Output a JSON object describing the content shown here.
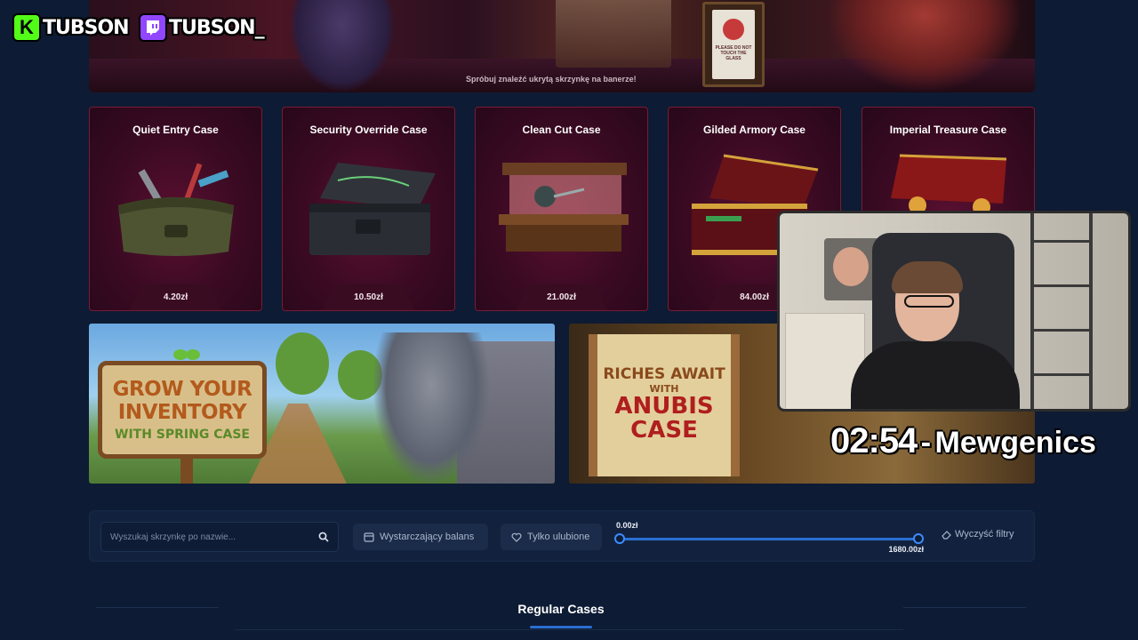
{
  "overlay": {
    "kick": {
      "name": "TUBSON",
      "logo_glyph": "K",
      "color": "#53fc18"
    },
    "twitch": {
      "name": "TUBSON_",
      "color": "#9146ff"
    },
    "timer": {
      "clock": "02:54",
      "separator": "-",
      "game": "Mewgenics"
    }
  },
  "banner": {
    "caption": "Spróbuj znaleźć ukrytą skrzynkę na banerze!",
    "sign_text": "PLEASE DO NOT TOUCH THE GLASS"
  },
  "cases": [
    {
      "name": "Quiet Entry Case",
      "price": "4.20zł",
      "icon": "duffel-bag-tools"
    },
    {
      "name": "Security Override Case",
      "price": "10.50zł",
      "icon": "toolbox-chest"
    },
    {
      "name": "Clean Cut Case",
      "price": "21.00zł",
      "icon": "glass-display-case"
    },
    {
      "name": "Gilded Armory Case",
      "price": "84.00zł",
      "icon": "ornate-chest"
    },
    {
      "name": "Imperial Treasure Case",
      "price": "",
      "icon": "treasure-chest"
    }
  ],
  "promos": {
    "grow": {
      "line1": "GROW YOUR",
      "line2": "INVENTORY",
      "line3": "WITH SPRING CASE"
    },
    "anubis": {
      "line1": "RICHES AWAIT",
      "line2": "WITH",
      "line3": "ANUBIS",
      "line4": "CASE"
    }
  },
  "filters": {
    "search_placeholder": "Wyszukaj skrzynkę po nazwie...",
    "balance_label": "Wystarczający balans",
    "favorites_label": "Tylko ulubione",
    "range_min_label": "0.00zł",
    "range_max_label": "1680.00zł",
    "range_min_value": 0,
    "range_max_value": 1680,
    "clear_label": "Wyczyść filtry"
  },
  "section": {
    "title": "Regular Cases"
  },
  "colors": {
    "accent": "#2a6fd0",
    "case_border": "#7a1a34",
    "background": "#0d1b34"
  }
}
